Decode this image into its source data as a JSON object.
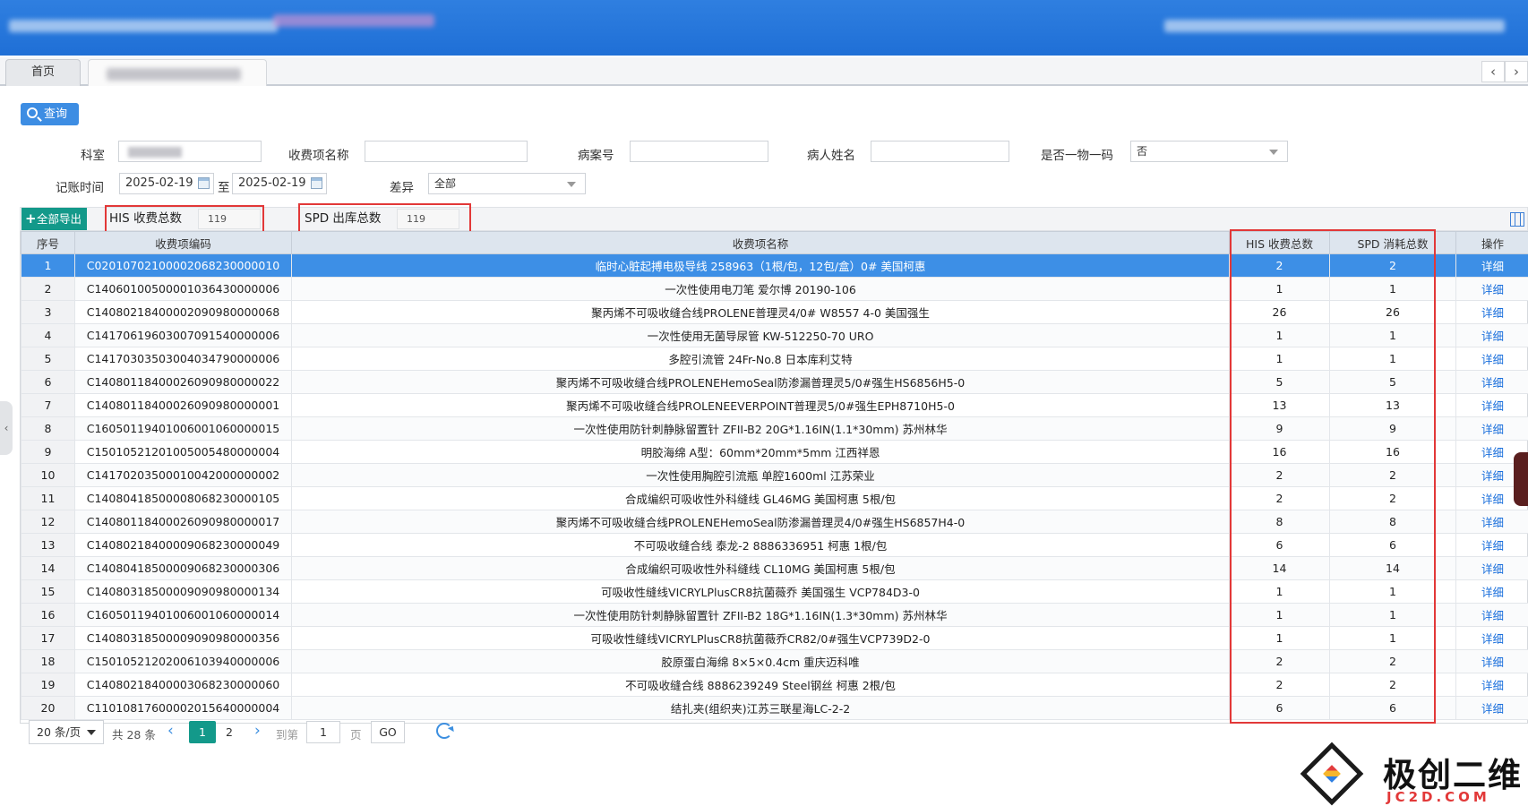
{
  "tabs": {
    "home": "首页",
    "prev_icon": "‹",
    "next_icon": "›"
  },
  "query_button": "查询",
  "filters": {
    "dept_label": "科室",
    "charge_item_label": "收费项名称",
    "charge_item_value": "",
    "case_no_label": "病案号",
    "case_no_value": "",
    "patient_label": "病人姓名",
    "patient_value": "",
    "one_code_label": "是否一物一码",
    "one_code_value": "否",
    "date_label": "记账时间",
    "date_from": "2025-02-19",
    "date_to_label": "至",
    "date_to": "2025-02-19",
    "diff_label": "差异",
    "diff_value": "全部"
  },
  "toolbar": {
    "export_label": "全部导出",
    "his_total_label": "HIS 收费总数",
    "his_total_value": "119",
    "spd_total_label": "SPD 出库总数",
    "spd_total_value": "119"
  },
  "table": {
    "headers": {
      "seq": "序号",
      "code": "收费项编码",
      "name": "收费项名称",
      "his": "HIS 收费总数",
      "spd": "SPD 消耗总数",
      "op": "操作"
    },
    "op_label": "详细",
    "rows": [
      {
        "seq": "1",
        "code": "C02010702100002068230000010",
        "name": "临时心脏起搏电极导线 258963（1根/包，12包/盒）0# 美国柯惠",
        "his": "2",
        "spd": "2"
      },
      {
        "seq": "2",
        "code": "C14060100500001036430000006",
        "name": "一次性使用电刀笔 爱尔博 20190-106",
        "his": "1",
        "spd": "1"
      },
      {
        "seq": "3",
        "code": "C14080218400002090980000068",
        "name": "聚丙烯不可吸收缝合线PROLENE普理灵4/0# W8557 4-0 美国强生",
        "his": "26",
        "spd": "26"
      },
      {
        "seq": "4",
        "code": "C14170619603007091540000006",
        "name": "一次性使用无菌导尿管 KW-512250-70 URO",
        "his": "1",
        "spd": "1"
      },
      {
        "seq": "5",
        "code": "C14170303503004034790000006",
        "name": "多腔引流管 24Fr-No.8 日本库利艾特",
        "his": "1",
        "spd": "1"
      },
      {
        "seq": "6",
        "code": "C14080118400026090980000022",
        "name": "聚丙烯不可吸收缝合线PROLENEHemoSeal防渗漏普理灵5/0#强生HS6856H5-0",
        "his": "5",
        "spd": "5"
      },
      {
        "seq": "7",
        "code": "C14080118400026090980000001",
        "name": "聚丙烯不可吸收缝合线PROLENEEVERPOINT普理灵5/0#强生EPH8710H5-0",
        "his": "13",
        "spd": "13"
      },
      {
        "seq": "8",
        "code": "C16050119401006001060000015",
        "name": "一次性使用防针刺静脉留置针 ZFII-B2 20G*1.16IN(1.1*30mm) 苏州林华",
        "his": "9",
        "spd": "9"
      },
      {
        "seq": "9",
        "code": "C15010521201005005480000004",
        "name": "明胶海绵 A型：60mm*20mm*5mm 江西祥恩",
        "his": "16",
        "spd": "16"
      },
      {
        "seq": "10",
        "code": "C14170203500010042000000002",
        "name": "一次性使用胸腔引流瓶 单腔1600ml 江苏荣业",
        "his": "2",
        "spd": "2"
      },
      {
        "seq": "11",
        "code": "C14080418500008068230000105",
        "name": "合成编织可吸收性外科缝线 GL46MG 美国柯惠 5根/包",
        "his": "2",
        "spd": "2"
      },
      {
        "seq": "12",
        "code": "C14080118400026090980000017",
        "name": "聚丙烯不可吸收缝合线PROLENEHemoSeal防渗漏普理灵4/0#强生HS6857H4-0",
        "his": "8",
        "spd": "8"
      },
      {
        "seq": "13",
        "code": "C14080218400009068230000049",
        "name": "不可吸收缝合线 泰龙-2 8886336951 柯惠 1根/包",
        "his": "6",
        "spd": "6"
      },
      {
        "seq": "14",
        "code": "C14080418500009068230000306",
        "name": "合成编织可吸收性外科缝线 CL10MG 美国柯惠 5根/包",
        "his": "14",
        "spd": "14"
      },
      {
        "seq": "15",
        "code": "C14080318500009090980000134",
        "name": "可吸收性缝线VICRYLPlusCR8抗菌薇乔 美国强生 VCP784D3-0",
        "his": "1",
        "spd": "1"
      },
      {
        "seq": "16",
        "code": "C16050119401006001060000014",
        "name": "一次性使用防针刺静脉留置针 ZFII-B2 18G*1.16IN(1.3*30mm) 苏州林华",
        "his": "1",
        "spd": "1"
      },
      {
        "seq": "17",
        "code": "C14080318500009090980000356",
        "name": "可吸收性缝线VICRYLPlusCR8抗菌薇乔CR82/0#强生VCP739D2-0",
        "his": "1",
        "spd": "1"
      },
      {
        "seq": "18",
        "code": "C15010521202006103940000006",
        "name": "胶原蛋白海绵 8×5×0.4cm 重庆迈科唯",
        "his": "2",
        "spd": "2"
      },
      {
        "seq": "19",
        "code": "C14080218400003068230000060",
        "name": "不可吸收缝合线 8886239249 Steel钢丝 柯惠 2根/包",
        "his": "2",
        "spd": "2"
      },
      {
        "seq": "20",
        "code": "C11010817600002015640000004",
        "name": "结扎夹(组织夹)江苏三联星海LC-2-2",
        "his": "6",
        "spd": "6"
      }
    ]
  },
  "pagination": {
    "page_size": "20 条/页",
    "total": "共 28 条",
    "prev": "‹",
    "page1": "1",
    "page2": "2",
    "next": "›",
    "goto_label": "到第",
    "goto_value": "1",
    "page_unit": "页",
    "go_label": "GO"
  },
  "watermark": {
    "title": "极创二维",
    "subtitle": "JC2D.COM"
  },
  "left_handle_icon": "‹",
  "colors": {
    "banner": "#1f6fd6",
    "selected_row": "#3d8fe6",
    "export_btn": "#13998a",
    "highlight_box": "#e23838",
    "link": "#1a6fdc"
  }
}
